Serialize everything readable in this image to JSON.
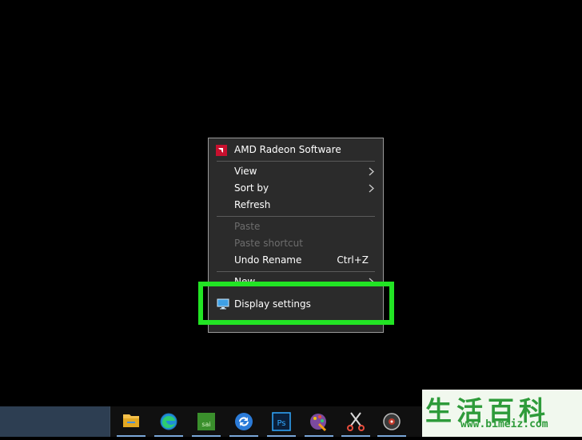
{
  "context_menu": {
    "items": [
      {
        "label": "AMD Radeon Software",
        "icon": "amd-logo-icon"
      },
      {
        "label": "View",
        "submenu": true
      },
      {
        "label": "Sort by",
        "submenu": true
      },
      {
        "label": "Refresh"
      },
      {
        "label": "Paste",
        "disabled": true
      },
      {
        "label": "Paste shortcut",
        "disabled": true
      },
      {
        "label": "Undo Rename",
        "shortcut": "Ctrl+Z"
      },
      {
        "label": "New",
        "submenu": true
      },
      {
        "label": "Display settings",
        "icon": "monitor-icon"
      }
    ]
  },
  "highlight_color": "#22e424",
  "taskbar": {
    "icons": [
      "file-explorer-icon",
      "edge-icon",
      "paint-tool-sai-icon",
      "sync-icon",
      "photoshop-icon",
      "paint-palette-icon",
      "scissors-icon",
      "disc-icon"
    ],
    "icon_labels": {
      "sai": "sai",
      "photoshop": "Ps"
    }
  },
  "watermark": {
    "chars": "生活百科",
    "url": "www.bimeiz.com"
  }
}
